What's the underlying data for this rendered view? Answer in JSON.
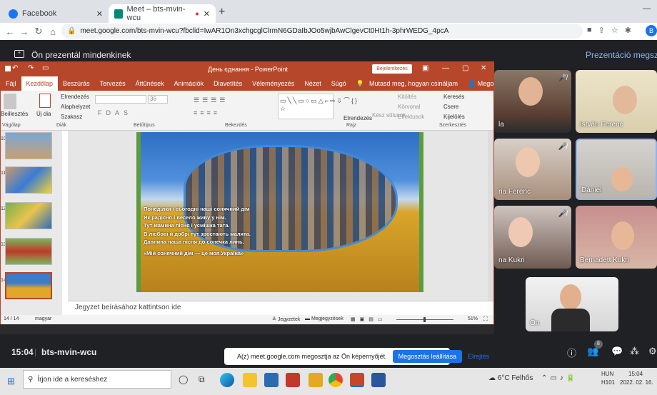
{
  "chrome": {
    "tabs": [
      {
        "label": "Facebook"
      },
      {
        "label": "Meet – bts-mvin-wcu"
      }
    ],
    "new_tab": "+",
    "url": "meet.google.com/bts-mvin-wcu?fbclid=IwAR1On3xchgcglClrmN6GDaIbJOo5wjbAwClgevCt0Ht1h-3phrWEDG_4pcA",
    "avatar": "B"
  },
  "meet": {
    "presenting_label": "Ön prezentál mindenkinek",
    "presentation_label": "Prezentáció megszakítá",
    "meeting_time": "15:04",
    "meeting_code": "bts-mvin-wcu",
    "share_banner_text": "A(z) meet.google.com megosztja az Ön képernyőjét.",
    "stop_share": "Megosztás leállítása",
    "hide": "Elrejtés",
    "participant_count": "8",
    "participants": [
      {
        "name": "la"
      },
      {
        "name": "István Ferenc"
      },
      {
        "name": "ria Ferenc"
      },
      {
        "name": "Dániel"
      },
      {
        "name": "na Kukri"
      },
      {
        "name": "Bernadett Kukri"
      },
      {
        "name": "Ön"
      }
    ]
  },
  "ppt": {
    "title": "День єднання - PowerPoint",
    "login": "Bejelentkezés",
    "ribbon_tabs": [
      "Fájl",
      "Kezdőlap",
      "Beszúrás",
      "Tervezés",
      "Áttűnések",
      "Animációk",
      "Diavetítés",
      "Véleményezés",
      "Nézet",
      "Súgó"
    ],
    "tell_me": "Mutasd meg, hogyan csináljam",
    "share": "Megosztás",
    "groups": {
      "clipboard": "Vágólap",
      "slides": "Diák",
      "font": "Betűtípus",
      "paragraph": "Bekezdés",
      "drawing": "Rajz",
      "editing": "Szerkesztés"
    },
    "buttons": {
      "paste": "Beillesztés",
      "new_slide": "Új dia",
      "layout": "Elrendezés",
      "reset": "Alaphelyzet",
      "section": "Szakasz",
      "arrange": "Elrendezés",
      "quick_styles": "Kész stílusok",
      "fill": "Kitöltés",
      "outline": "Körvonal",
      "effects": "Effektusok",
      "find": "Keresés",
      "replace": "Csere",
      "select": "Kijelölés"
    },
    "font_size": "36",
    "slide_numbers": [
      "10",
      "11",
      "12",
      "13",
      "14"
    ],
    "slide_lines": [
      "Понеділки і сьогодні наші сонячний дім",
      "Як радісно і весело живу у нім.",
      "Тут мамина пісня і усмішка тата.",
      "В любові й добрі тут зростають малята.",
      "Давнина наша пісня до сонечка линь.",
      "«Мій сонячний дім — це моя Україна»"
    ],
    "notes_placeholder": "Jegyzet beírásához kattintson ide",
    "status": {
      "slide": "14 / 14",
      "lang": "magyar",
      "notes": "Jegyzetek",
      "comments": "Megjegyzések",
      "zoom": "51%"
    }
  },
  "taskbar": {
    "search_placeholder": "Írjon ide a kereséshez",
    "weather": "6°C Felhős",
    "lang_top": "HUN",
    "lang_bottom": "H101",
    "time": "15:04",
    "date": "2022. 02. 16."
  }
}
